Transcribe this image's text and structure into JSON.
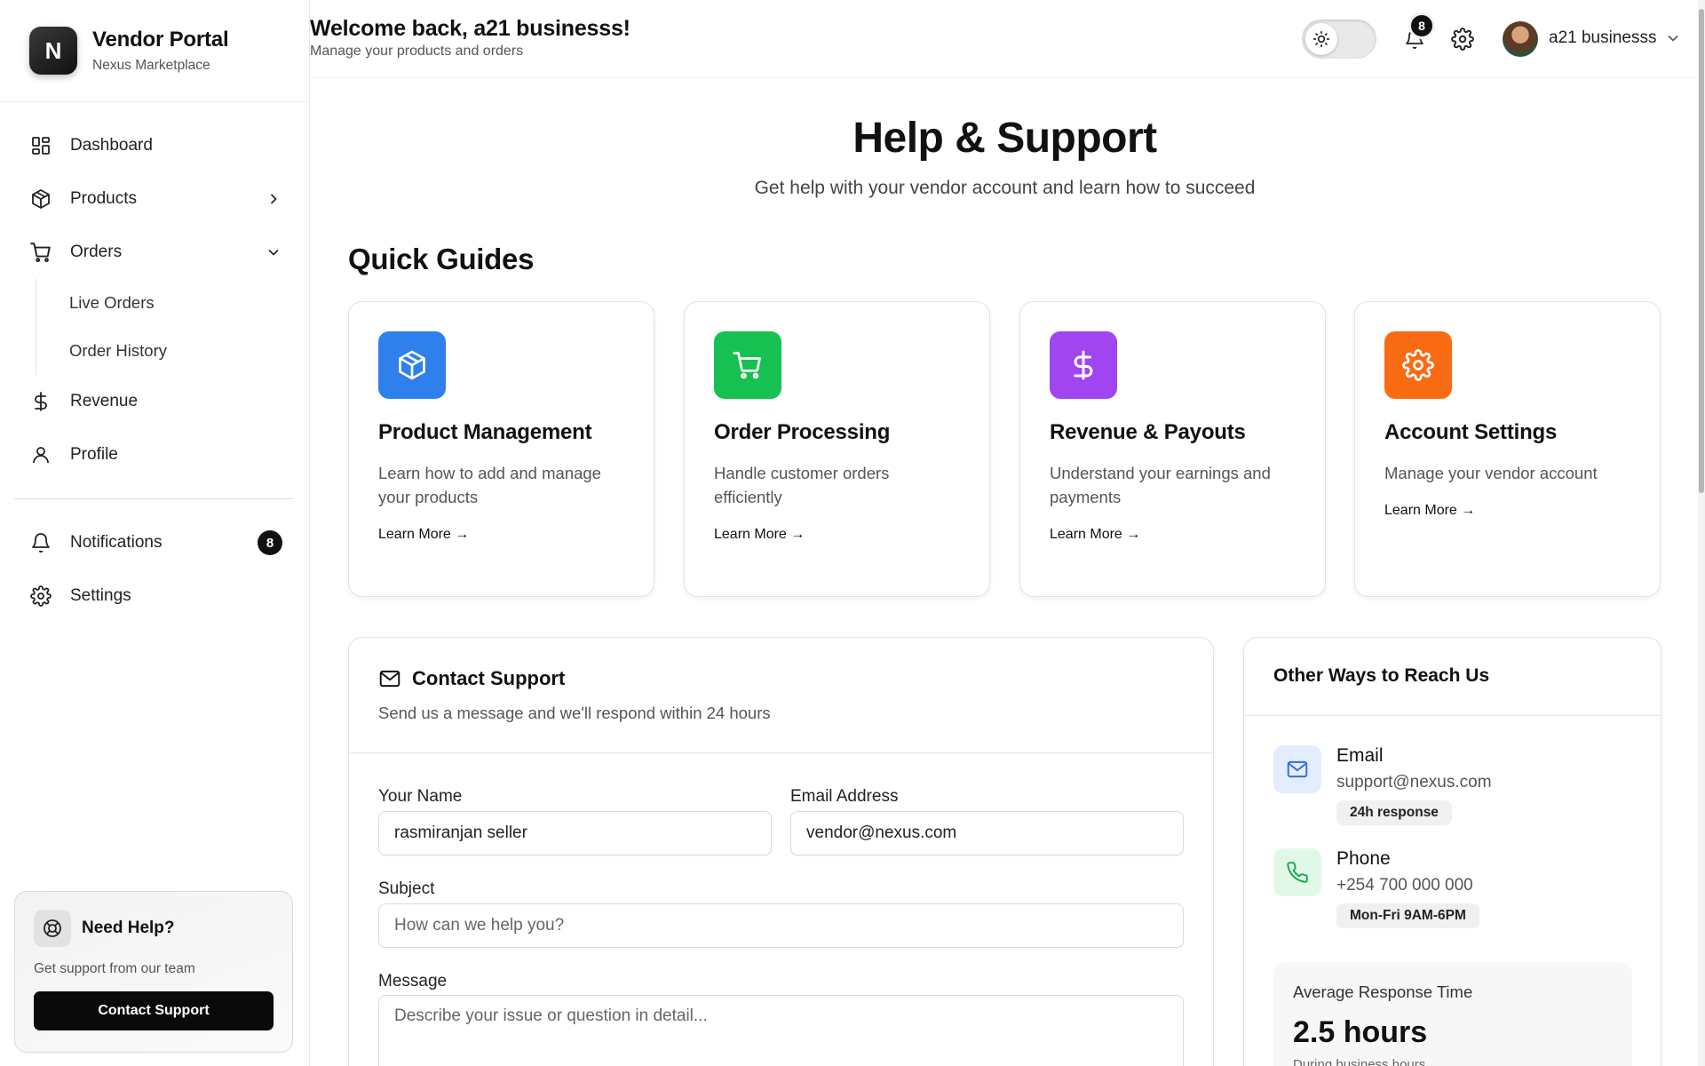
{
  "brand": {
    "logo_letter": "N",
    "title": "Vendor Portal",
    "subtitle": "Nexus Marketplace"
  },
  "sidebar": {
    "items": [
      {
        "label": "Dashboard",
        "icon": "dashboard-icon"
      },
      {
        "label": "Products",
        "icon": "box-icon",
        "chevron": "right"
      },
      {
        "label": "Orders",
        "icon": "cart-icon",
        "chevron": "down"
      },
      {
        "label": "Revenue",
        "icon": "dollar-icon"
      },
      {
        "label": "Profile",
        "icon": "user-icon"
      },
      {
        "label": "Notifications",
        "icon": "bell-icon",
        "badge": "8"
      },
      {
        "label": "Settings",
        "icon": "gear-icon"
      }
    ],
    "orders_sub": [
      "Live Orders",
      "Order History"
    ],
    "help": {
      "title": "Need Help?",
      "subtitle": "Get support from our team",
      "button": "Contact Support"
    }
  },
  "header": {
    "welcome": "Welcome back, a21 businesss!",
    "subtitle": "Manage your products and orders",
    "notification_count": "8",
    "user_name": "a21 businesss"
  },
  "page": {
    "title": "Help & Support",
    "subtitle": "Get help with your vendor account and learn how to succeed",
    "guides_title": "Quick Guides",
    "guides": [
      {
        "title": "Product Management",
        "desc": "Learn how to add and manage your products",
        "link": "Learn More →",
        "color": "#2f80ed",
        "icon": "box-icon"
      },
      {
        "title": "Order Processing",
        "desc": "Handle customer orders efficiently",
        "link": "Learn More →",
        "color": "#16c152",
        "icon": "cart-icon"
      },
      {
        "title": "Revenue & Payouts",
        "desc": "Understand your earnings and payments",
        "link": "Learn More →",
        "color": "#a145f0",
        "icon": "dollar-icon"
      },
      {
        "title": "Account Settings",
        "desc": "Manage your vendor account",
        "link": "Learn More →",
        "color": "#f96b13",
        "icon": "gear-icon"
      }
    ]
  },
  "contact": {
    "title": "Contact Support",
    "subtitle": "Send us a message and we'll respond within 24 hours",
    "name_label": "Your Name",
    "name_value": "rasmiranjan seller",
    "email_label": "Email Address",
    "email_value": "vendor@nexus.com",
    "subject_label": "Subject",
    "subject_placeholder": "How can we help you?",
    "message_label": "Message",
    "message_placeholder": "Describe your issue or question in detail..."
  },
  "reach": {
    "title": "Other Ways to Reach Us",
    "email": {
      "label": "Email",
      "value": "support@nexus.com",
      "tag": "24h response"
    },
    "phone": {
      "label": "Phone",
      "value": "+254 700 000 000",
      "tag": "Mon-Fri 9AM-6PM"
    },
    "avg_label": "Average Response Time",
    "avg_value": "2.5 hours",
    "avg_note": "During business hours"
  }
}
